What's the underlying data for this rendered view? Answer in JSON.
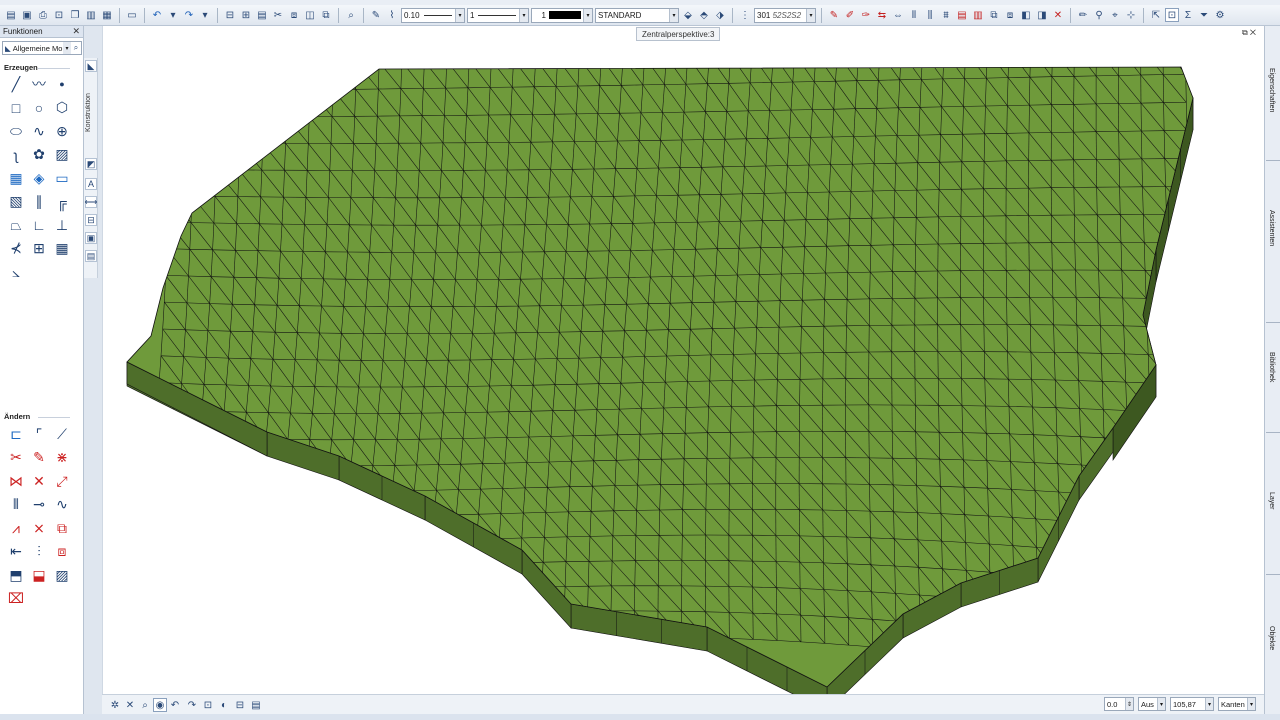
{
  "toolbar": {
    "line_thickness": "0.10",
    "line_type": "1",
    "pen_color_index": "1",
    "format_name": "STANDARD",
    "layer_code": "301",
    "layer_name": "52S2S2"
  },
  "functions_panel": {
    "title": "Funktionen",
    "close_glyph": "✕",
    "module_select": "Allgemeine Mo...",
    "group_create": "Erzeugen",
    "group_modify": "Ändern",
    "konstruktion_label": "Konstruktion"
  },
  "viewport": {
    "view_label": "Zentralperspektive:3",
    "window_controls": "⧉ ✕"
  },
  "right_tabs": [
    "Eigenschaften",
    "Assistenten",
    "Bibliothek",
    "Layer",
    "Objekte"
  ],
  "bottom_bar": {
    "angle_value": "0.0",
    "snap_mode": "Aus",
    "zoom_value": "105,87",
    "display_mode": "Kanten"
  },
  "colors": {
    "terrain_top": "#6f9a3b",
    "terrain_side": "#4e6e2a",
    "terrain_side_dark": "#3d5820",
    "mesh_line": "#111111"
  }
}
